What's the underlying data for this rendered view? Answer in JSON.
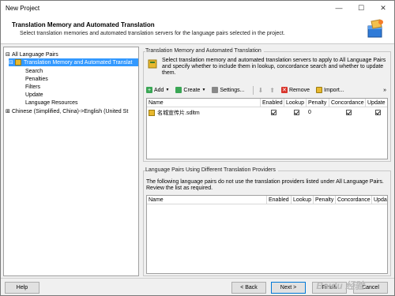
{
  "window": {
    "title": "New Project",
    "minimize": "—",
    "maximize": "☐",
    "close": "✕"
  },
  "header": {
    "title": "Translation Memory and Automated Translation",
    "subtitle": "Select translation memories and automated translation servers for the language pairs selected in the project."
  },
  "tree": {
    "items": [
      {
        "label": "All Language Pairs",
        "level": 0
      },
      {
        "label": "Translation Memory and Automated Translat",
        "level": 1,
        "selected": true
      },
      {
        "label": "Search",
        "level": 2
      },
      {
        "label": "Penalties",
        "level": 2
      },
      {
        "label": "Filters",
        "level": 2
      },
      {
        "label": "Update",
        "level": 2
      },
      {
        "label": "Language Resources",
        "level": 2
      },
      {
        "label": "Chinese (Simplified, China)->English (United St",
        "level": 0
      }
    ]
  },
  "main": {
    "section1_title": "Translation Memory and Automated Translation",
    "info_text": "Select translation memory and automated translation servers to apply to All Language Pairs and specify whether to include them in lookup, concordance search and whether to update them.",
    "toolbar": {
      "add": "Add",
      "create": "Create",
      "settings": "Settings...",
      "remove": "Remove",
      "import": "Import...",
      "more": "»"
    },
    "tm_grid": {
      "columns": [
        "Name",
        "Enabled",
        "Lookup",
        "Penalty",
        "Concordance",
        "Update"
      ],
      "rows": [
        {
          "name": "名城宣传片.sdltm",
          "enabled": true,
          "lookup": true,
          "penalty": "0",
          "concordance": true,
          "update": true
        }
      ]
    },
    "section2_title": "Language Pairs Using Different Translation Providers",
    "section2_text": "The following language pairs do not use the translation providers listed under All Language Pairs. Review the list as required.",
    "lp_grid": {
      "columns": [
        "Name",
        "Enabled",
        "Lookup",
        "Penalty",
        "Concordance",
        "Upda"
      ]
    }
  },
  "footer": {
    "help": "Help",
    "back": "< Back",
    "next": "Next >",
    "finish": "Finish",
    "cancel": "Cancel"
  },
  "watermark": "Baidu 经验"
}
